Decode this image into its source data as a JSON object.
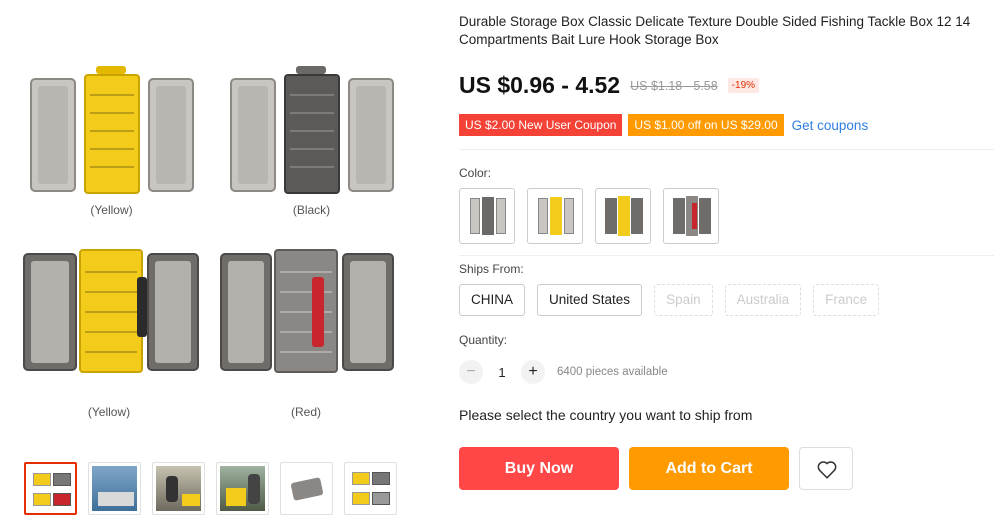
{
  "product": {
    "title": "Durable Storage Box Classic Delicate Texture Double Sided Fishing Tackle Box 12 14 Compartments Bait Lure Hook Storage Box",
    "price": "US $0.96 - 4.52",
    "original_price": "US $1.18 - 5.58",
    "discount": "-19%"
  },
  "gallery": {
    "captions": [
      "(Yellow)",
      "(Black)",
      "(Yellow)",
      "(Red)"
    ],
    "thumbnail_count": 6,
    "active_thumbnail": 0
  },
  "coupons": {
    "new_user": "US $2.00 New User Coupon",
    "store": "US $1.00 off on US $29.00",
    "link": "Get coupons"
  },
  "color": {
    "label": "Color:",
    "options": [
      "gray",
      "yellow",
      "black-yellow",
      "red"
    ]
  },
  "ships_from": {
    "label": "Ships From:",
    "options": [
      "CHINA",
      "United States",
      "Spain",
      "Australia",
      "France"
    ],
    "disabled": [
      "Spain",
      "Australia",
      "France"
    ]
  },
  "quantity": {
    "label": "Quantity:",
    "value": "1",
    "minus": "−",
    "plus": "+",
    "available": "6400 pieces available"
  },
  "notice": "Please select the country you want to ship from",
  "buttons": {
    "buy": "Buy Now",
    "cart": "Add to Cart",
    "wishlist_icon": "heart-icon"
  },
  "colors": {
    "price_red": "#e62e04",
    "coupon_red": "#f44236",
    "coupon_orange": "#ff9a00",
    "buy": "#ff4747",
    "cart": "#ff9a00",
    "link": "#2f7ee3",
    "yellow": "#f3cc1b"
  }
}
